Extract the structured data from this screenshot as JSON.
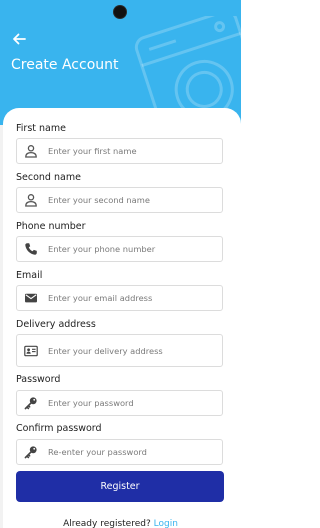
{
  "header": {
    "title": "Create Account",
    "background": "#39b4ee",
    "back_icon": "arrow-left-icon"
  },
  "form": {
    "fields": [
      {
        "label": "First name",
        "placeholder": "Enter your first name",
        "icon": "person-icon"
      },
      {
        "label": "Second name",
        "placeholder": "Enter your second name",
        "icon": "person-icon"
      },
      {
        "label": "Phone number",
        "placeholder": "Enter your phone number",
        "icon": "phone-icon"
      },
      {
        "label": "Email",
        "placeholder": "Enter your email address",
        "icon": "mail-icon"
      },
      {
        "label": "Delivery address",
        "placeholder": "Enter your delivery address",
        "icon": "contact-card-icon"
      },
      {
        "label": "Password",
        "placeholder": "Enter your password",
        "icon": "key-icon"
      },
      {
        "label": "Confirm password",
        "placeholder": "Re-enter your password",
        "icon": "key-icon"
      }
    ],
    "submit_label": "Register",
    "submit_color": "#1f2ea6"
  },
  "footer": {
    "prompt": "Already registered?",
    "link": "Login",
    "link_color": "#39b4ee"
  }
}
